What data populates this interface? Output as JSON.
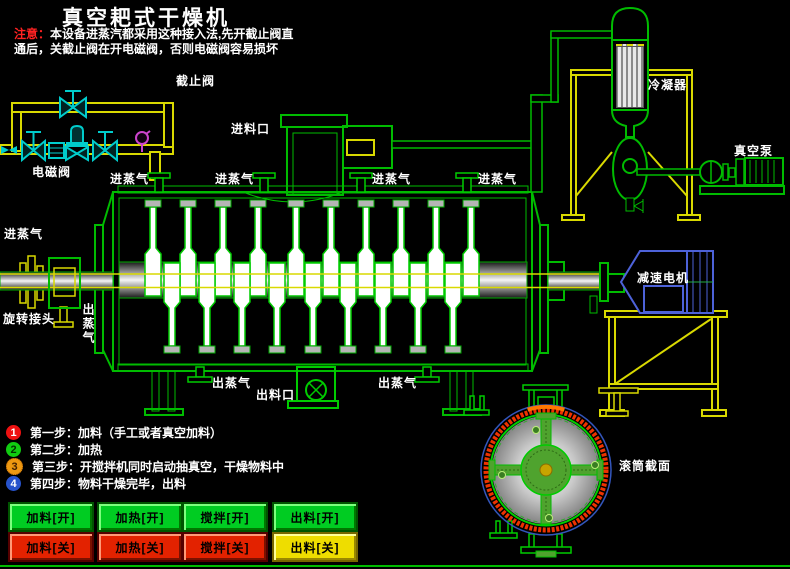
{
  "title": "真空耙式干燥机",
  "note": {
    "tag": "注意：",
    "line1": "本设备进蒸汽都采用这种接入法,先开截止阀直",
    "line2": "通后，关截止阀在开电磁阀，否则电磁阀容易损坏"
  },
  "labels": {
    "stop_valve": "截止阀",
    "solenoid_valve": "电磁阀",
    "feed_inlet": "进料口",
    "steam_in": "进蒸气",
    "steam_out": "出蒸气",
    "discharge_outlet": "出料口",
    "rotary_joint": "旋转接头",
    "condenser": "冷凝器",
    "vacuum_pump": "真空泵",
    "gear_motor": "减速电机",
    "drum_section": "滚筒截面"
  },
  "steps": [
    {
      "num": "1",
      "text": "第一步：加料（手工或者真空加料）"
    },
    {
      "num": "2",
      "text": "第二步：加热"
    },
    {
      "num": "3",
      "text": "第三步：开搅拌机同时启动抽真空，干燥物料中"
    },
    {
      "num": "4",
      "text": "第四步：物料干燥完毕，出料"
    }
  ],
  "buttons": [
    {
      "label": "加料[开]",
      "state": "on"
    },
    {
      "label": "加热[开]",
      "state": "on"
    },
    {
      "label": "搅拌[开]",
      "state": "on"
    },
    {
      "label": "出料[开]",
      "state": "on"
    },
    {
      "label": "加料[关]",
      "state": "off"
    },
    {
      "label": "加热[关]",
      "state": "off"
    },
    {
      "label": "搅拌[关]",
      "state": "off"
    },
    {
      "label": "出料[关]",
      "state": "off"
    }
  ],
  "colors": {
    "background": "#000000",
    "line_green": "#00bb00",
    "pipe_yellow": "#d9d900",
    "valve_cyan": "#00cccc",
    "gauge_magenta": "#cc44cc",
    "motor_blue": "#4d62d9",
    "title_text": "#ffffff",
    "note_red": "#ff2222",
    "btn_on_green": "#00cc22",
    "btn_off_red": "#e32200",
    "btn_off_yellow": "#eedd00",
    "step1": "#ee1111",
    "step2": "#11cc11",
    "step3": "#ee9911",
    "step4": "#2753cc"
  }
}
